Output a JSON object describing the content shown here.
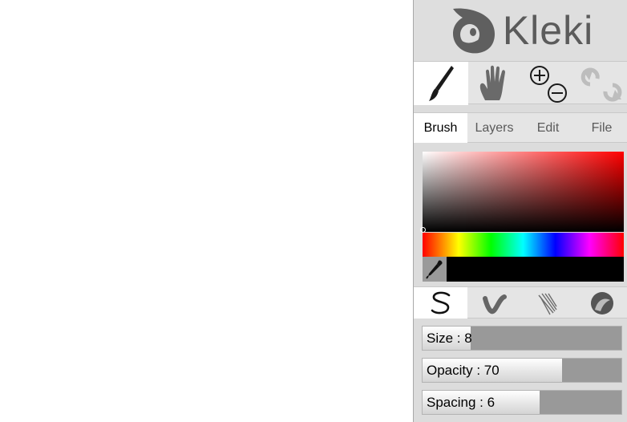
{
  "app": {
    "name": "Kleki"
  },
  "tools": [
    {
      "name": "brush-tool-icon",
      "active": true
    },
    {
      "name": "hand-tool-icon",
      "active": false
    },
    {
      "name": "zoom-tool-icon",
      "active": false
    },
    {
      "name": "undo-redo-icon",
      "active": false
    }
  ],
  "tabs": [
    {
      "label": "Brush",
      "active": true
    },
    {
      "label": "Layers",
      "active": false
    },
    {
      "label": "Edit",
      "active": false
    },
    {
      "label": "File",
      "active": false
    }
  ],
  "color": {
    "current": "#000000",
    "hue": "#ff0000"
  },
  "brush_types": [
    {
      "name": "pen-brush-icon",
      "active": true
    },
    {
      "name": "blend-brush-icon",
      "active": false
    },
    {
      "name": "sketchy-brush-icon",
      "active": false
    },
    {
      "name": "smudge-brush-icon",
      "active": false
    }
  ],
  "sliders": {
    "size": {
      "label": "Size : 8",
      "fraction": 0.24
    },
    "opacity": {
      "label": "Opacity : 70",
      "fraction": 0.7
    },
    "spacing": {
      "label": "Spacing : 6",
      "fraction": 0.59
    }
  }
}
